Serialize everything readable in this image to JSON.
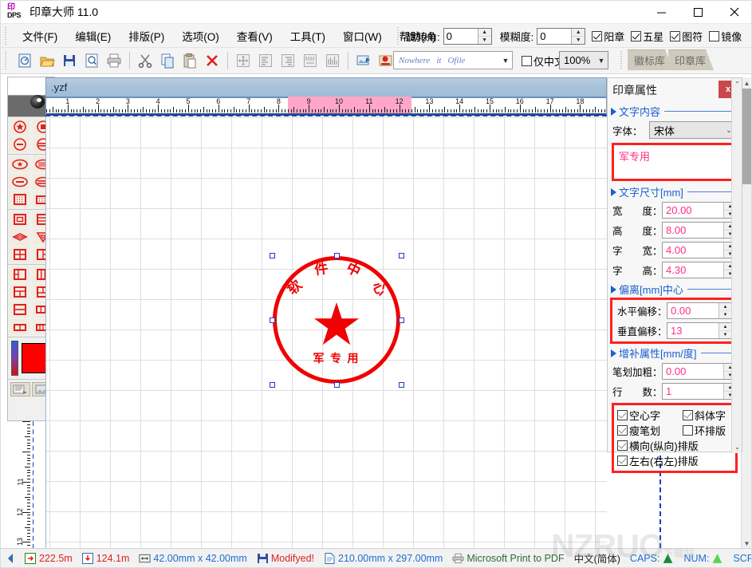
{
  "window": {
    "app_title": "印章大师 11.0",
    "logo_line1": "印",
    "logo_line2": "DPS",
    "minimize": "minimize-icon",
    "maximize": "maximize-icon",
    "close": "close-icon"
  },
  "menu": {
    "items": [
      {
        "label": "文件(F)"
      },
      {
        "label": "编辑(E)"
      },
      {
        "label": "排版(P)"
      },
      {
        "label": "选项(O)"
      },
      {
        "label": "查看(V)"
      },
      {
        "label": "工具(T)"
      },
      {
        "label": "窗口(W)"
      },
      {
        "label": "帮助(H)"
      }
    ],
    "rotation": {
      "label": "旋转角:",
      "value": "0"
    },
    "blur": {
      "label": "模糊度:",
      "value": "0"
    },
    "checks": [
      {
        "label": "阳章",
        "checked": true
      },
      {
        "label": "五星",
        "checked": true
      },
      {
        "label": "图符",
        "checked": true
      },
      {
        "label": "镜像",
        "checked": false
      }
    ]
  },
  "toolbar": {
    "buttons": [
      {
        "name": "new-icon"
      },
      {
        "name": "open-icon"
      },
      {
        "name": "save-icon"
      },
      {
        "name": "print-preview-icon"
      },
      {
        "name": "print-icon"
      },
      {
        "name": "cut-icon"
      },
      {
        "name": "copy-icon"
      },
      {
        "name": "paste-icon"
      },
      {
        "name": "delete-icon"
      },
      {
        "name": "align-center-icon"
      },
      {
        "name": "align-left-icon"
      },
      {
        "name": "align-right-icon"
      },
      {
        "name": "distribute-h-icon"
      },
      {
        "name": "distribute-v-icon"
      },
      {
        "name": "export-image-icon"
      },
      {
        "name": "stamp-export-icon"
      },
      {
        "name": "word-export-icon"
      },
      {
        "name": "excel-export-icon"
      }
    ],
    "font_sample": [
      "Nowhere",
      "it",
      "Ofile"
    ],
    "only_chinese": {
      "label": "仅中文",
      "checked": false
    },
    "zoom": "100%",
    "lib_tabs": [
      {
        "label": "徽标库"
      },
      {
        "label": "印章库"
      }
    ]
  },
  "document": {
    "tab_title": ".yzf",
    "h_ruler": {
      "max": 19,
      "highlight_start": 8.3,
      "highlight_end": 12.4
    },
    "v_ruler": {
      "ticks": [
        11,
        12,
        13
      ]
    }
  },
  "stamp": {
    "arc_text": "软件中心",
    "bottom_text": "军 专 用",
    "star": "five-point-star",
    "color": "#f00000"
  },
  "props": {
    "title": "印章属性",
    "close_label": "x",
    "sections": {
      "content": "文字内容",
      "size": "文字尺寸[mm]",
      "offset": "偏离[mm]中心",
      "extra": "增补属性[mm/度]"
    },
    "font_label": "字体：",
    "font_value": "宋体",
    "text_value": "军专用",
    "fields": [
      {
        "label": "宽　　度：",
        "value": "20.00"
      },
      {
        "label": "高　　度：",
        "value": "8.00"
      },
      {
        "label": "字　　宽：",
        "value": "4.00"
      },
      {
        "label": "字　　高：",
        "value": "4.30"
      }
    ],
    "offset_fields": [
      {
        "label": "水平偏移：",
        "value": "0.00"
      },
      {
        "label": "垂直偏移：",
        "value": "13"
      }
    ],
    "extra_fields": [
      {
        "label": "笔划加粗：",
        "value": "0.00"
      },
      {
        "label": "行　　数：",
        "value": "1"
      }
    ],
    "flags": [
      {
        "label": "空心字",
        "checked": true
      },
      {
        "label": "斜体字",
        "checked": true
      },
      {
        "label": "瘦笔划",
        "checked": true
      },
      {
        "label": "环排版",
        "checked": false
      },
      {
        "label": "横向(纵向)排版",
        "checked": true
      },
      {
        "label": "左右(右左)排版",
        "checked": true
      }
    ]
  },
  "status": {
    "pos_x": "222.5m",
    "pos_y": "124.1m",
    "object_size": "42.00mm x 42.00mm",
    "modified": "Modifyed!",
    "page_size": "210.00mm x 297.00mm",
    "printer": "Microsoft Print to PDF",
    "ime": "中文(简体)",
    "caps": "CAPS:",
    "num": "NUM:",
    "scrl": "SCRL:"
  },
  "watermark": {
    "text": "NZRUO",
    "sub": "下载站"
  },
  "colors": {
    "accent_red": "#ff2020",
    "stamp_red": "#f00000",
    "field_pink": "#ff2e87",
    "section_blue": "#1a5fd0",
    "ruler_highlight": "#ffa6c9"
  }
}
